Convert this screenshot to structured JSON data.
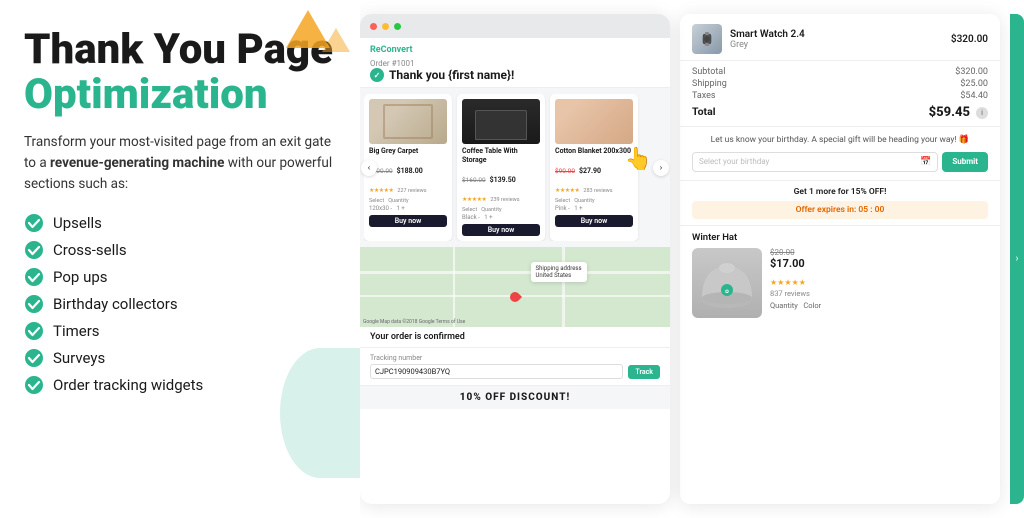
{
  "left": {
    "title_line1": "Thank You Page",
    "title_line2": "Optimization",
    "subtitle": "Transform your most-visited page from an exit gate to a",
    "subtitle_bold": "revenue-generating machine",
    "subtitle_end": "with our powerful sections such as:",
    "features": [
      "Upsells",
      "Cross-sells",
      "Pop ups",
      "Birthday collectors",
      "Timers",
      "Surveys",
      "Order tracking widgets"
    ]
  },
  "mock": {
    "logo": "ReConvert",
    "order_num": "Order #1001",
    "thank_you": "Thank you {first name}!",
    "products": [
      {
        "name": "Big Grey Carpet",
        "price_old": "$200.00",
        "price_new": "$188.00",
        "stars": "★★★★★",
        "reviews": "227 reviews",
        "color_label": "Select",
        "quantity_label": "Quantity",
        "size": "120x30",
        "buy": "Buy now"
      },
      {
        "name": "Coffee Table With Storage",
        "price_old": "$160.00",
        "price_new": "$139.50",
        "stars": "★★★★★",
        "reviews": "239 reviews",
        "color_label": "Select",
        "quantity_label": "Quantity",
        "color": "Black",
        "buy": "Buy now"
      },
      {
        "name": "Cotton Blanket 200x300",
        "price_old": "$90.00",
        "price_new": "$27.90",
        "stars": "★★★★★",
        "reviews": "283 reviews",
        "color_label": "Select",
        "quantity_label": "Quantity",
        "color": "Pink",
        "buy": "Buy now"
      }
    ],
    "map_tooltip_line1": "Shipping address",
    "map_tooltip_line2": "United States",
    "map_watermark": "Google",
    "order_confirmed": "Your order is confirmed",
    "tracking_label": "Tracking number",
    "tracking_number": "CJPC190909430B7YQ",
    "track_btn": "Track",
    "discount_banner": "10% OFF DISCOUNT!"
  },
  "right_panel": {
    "product_name": "Smart Watch 2.4",
    "product_variant": "Grey",
    "product_price": "$320.00",
    "subtotal_label": "Subtotal",
    "subtotal": "$320.00",
    "shipping_label": "Shipping",
    "shipping": "$25.00",
    "taxes_label": "Taxes",
    "taxes": "$54.40",
    "total_label": "Total",
    "total": "$59.45",
    "birthday_title": "Let us know your birthday. A special gift will be heading your way! 🎁",
    "birthday_placeholder": "Select your birthday",
    "submit_btn": "Submit",
    "upsell_label": "Get 1 more for 15% OFF!",
    "offer_timer": "Offer expires in: 05 : 00",
    "hat_label": "Winter Hat",
    "hat_price_old": "$20.00",
    "hat_price_new": "$17.00",
    "hat_stars": "★★★★★",
    "hat_reviews": "837 reviews",
    "hat_quantity": "Quantity",
    "hat_color": "Color"
  }
}
